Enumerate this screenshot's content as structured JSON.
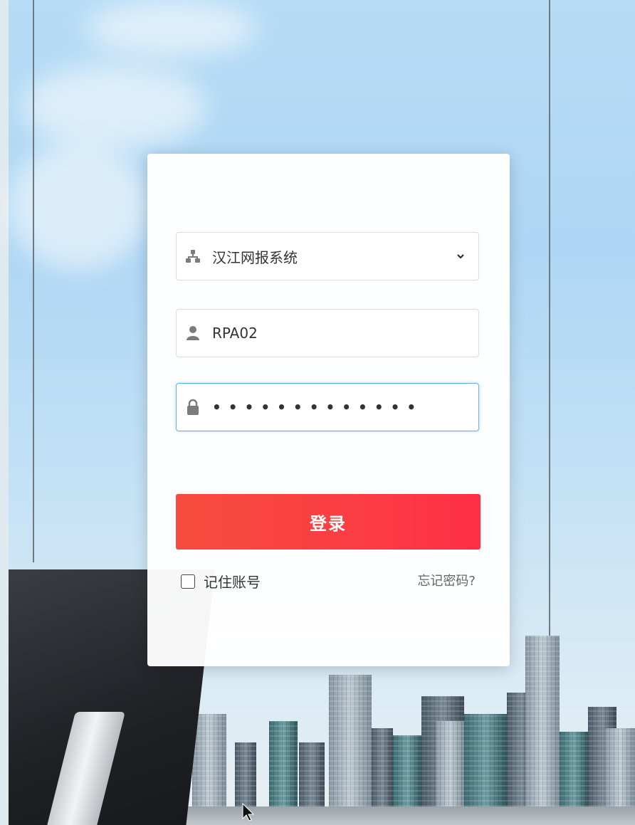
{
  "login": {
    "system_select": {
      "value": "汉江网报系统",
      "icon": "sitemap-icon"
    },
    "username": {
      "value": "RPA02",
      "icon": "user-icon"
    },
    "password": {
      "masked_value": "•••••••••••••",
      "icon": "lock-icon"
    },
    "submit_label": "登录",
    "remember_label": "记住账号",
    "remember_checked": false,
    "forgot_label": "忘记密码?"
  },
  "colors": {
    "button": "#fb3d44",
    "focus_border": "#62b0e0"
  }
}
